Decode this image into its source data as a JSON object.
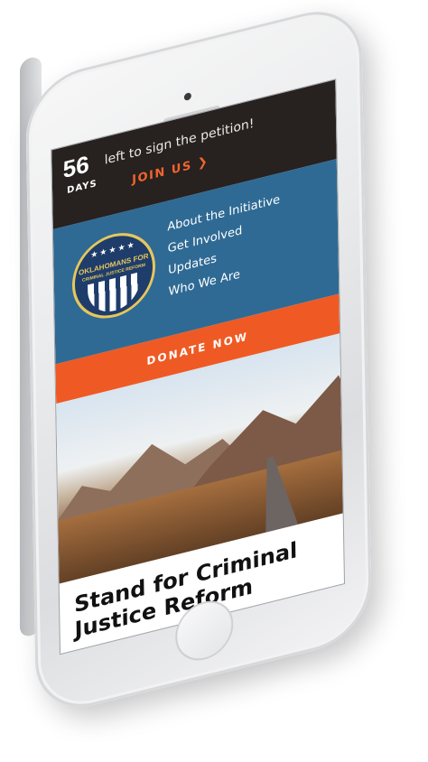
{
  "countdown": {
    "number": "56",
    "unit": "DAYS",
    "message": "left to sign the petition!",
    "cta": "JOIN US"
  },
  "logo": {
    "line1": "OKLAHOMANS FOR",
    "line2": "CRIMINAL JUSTICE REFORM"
  },
  "nav": {
    "items": [
      "About the Initiative",
      "Get Involved",
      "Updates",
      "Who We Are"
    ]
  },
  "donate": {
    "label": "DONATE NOW"
  },
  "hero": {
    "headline": "Stand for Criminal Justice Reform"
  },
  "colors": {
    "topbar": "#272120",
    "nav_bg": "#2f6a94",
    "accent": "#ef5a24",
    "seal_gold": "#e6c75c",
    "seal_blue": "#1f3d6b"
  },
  "icons": {
    "join_arrow": "chevron-right-icon"
  }
}
